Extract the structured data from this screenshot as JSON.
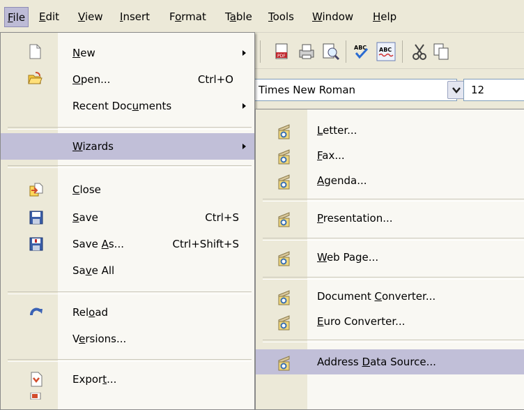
{
  "menubar": {
    "items": [
      {
        "label": "File",
        "u": "F"
      },
      {
        "label": "Edit",
        "u": "E"
      },
      {
        "label": "View",
        "u": "V"
      },
      {
        "label": "Insert",
        "u": "I"
      },
      {
        "label": "Format",
        "u": "o"
      },
      {
        "label": "Table",
        "u": "a"
      },
      {
        "label": "Tools",
        "u": "T"
      },
      {
        "label": "Window",
        "u": "W"
      },
      {
        "label": "Help",
        "u": "H"
      }
    ]
  },
  "toolbar": {
    "font_name": "Times New Roman",
    "font_size": "12",
    "icons": [
      "edit-icon",
      "pdf-icon",
      "print-icon",
      "preview-icon",
      "spellcheck-icon",
      "autospell-icon",
      "cut-icon",
      "copy-icon"
    ]
  },
  "file_menu": {
    "new": {
      "pre": "",
      "u": "N",
      "post": "ew"
    },
    "open": {
      "pre": "",
      "u": "O",
      "post": "pen...",
      "accel": "Ctrl+O"
    },
    "recent": {
      "pre": "Recent Doc",
      "u": "u",
      "post": "ments"
    },
    "wizards": {
      "pre": "",
      "u": "W",
      "post": "izards"
    },
    "close": {
      "pre": "",
      "u": "C",
      "post": "lose"
    },
    "save": {
      "pre": "",
      "u": "S",
      "post": "ave",
      "accel": "Ctrl+S"
    },
    "save_as": {
      "pre": "Save ",
      "u": "A",
      "post": "s...",
      "accel": "Ctrl+Shift+S"
    },
    "save_all": {
      "pre": "Sa",
      "u": "v",
      "post": "e All"
    },
    "reload": {
      "pre": "Rel",
      "u": "o",
      "post": "ad"
    },
    "versions": {
      "pre": "V",
      "u": "e",
      "post": "rsions..."
    },
    "export": {
      "pre": "Expor",
      "u": "t",
      "post": "..."
    }
  },
  "wizards_menu": {
    "letter": {
      "pre": "",
      "u": "L",
      "post": "etter..."
    },
    "fax": {
      "pre": "",
      "u": "F",
      "post": "ax..."
    },
    "agenda": {
      "pre": "",
      "u": "A",
      "post": "genda..."
    },
    "presentation": {
      "pre": "",
      "u": "P",
      "post": "resentation..."
    },
    "web_page": {
      "pre": "",
      "u": "W",
      "post": "eb Page..."
    },
    "doc_converter": {
      "pre": "Document ",
      "u": "C",
      "post": "onverter..."
    },
    "euro_converter": {
      "pre": "",
      "u": "E",
      "post": "uro Converter..."
    },
    "address_source": {
      "pre": "Address ",
      "u": "D",
      "post": "ata Source..."
    }
  }
}
